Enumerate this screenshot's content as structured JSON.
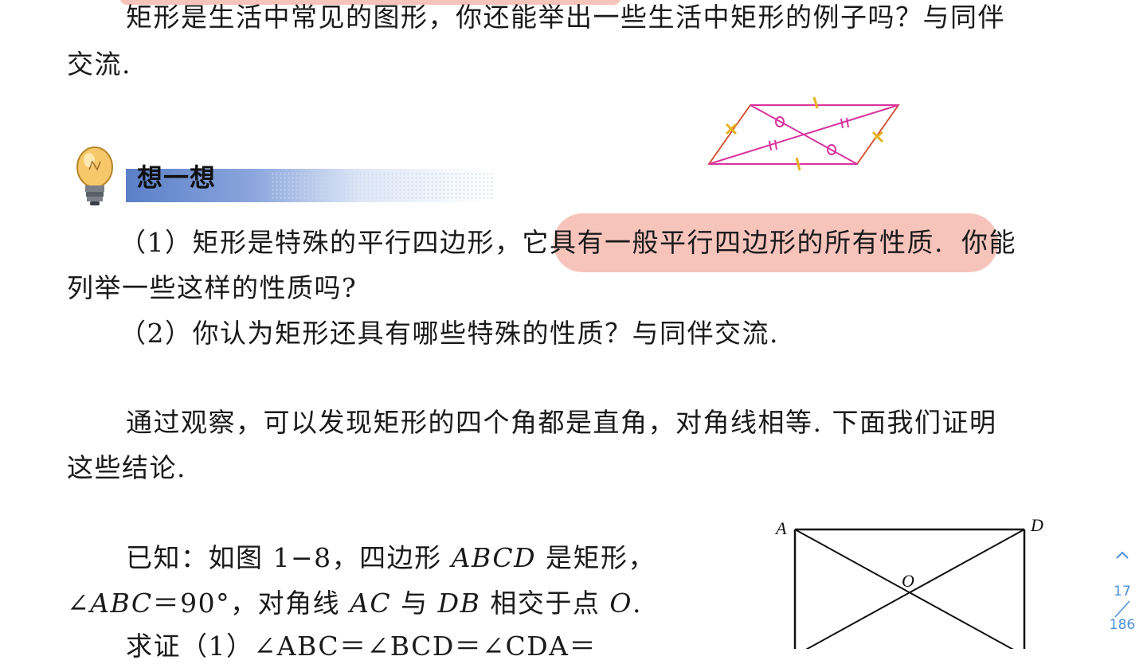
{
  "paragraph1": {
    "line1": "矩形是生活中常见的图形，你还能举出一些生活中矩形的例子吗？与同伴",
    "line2": "交流."
  },
  "think_section": {
    "title": "想一想",
    "q1_line1_a": "（1）矩形是特殊的平行四边形，它",
    "q1_line1_b": "具有一般平行四边形的所有性质.",
    "q1_line1_c": "你能",
    "q1_line2": "列举一些这样的性质吗?",
    "q2": "（2）你认为矩形还具有哪些特殊的性质？与同伴交流."
  },
  "paragraph2": {
    "line1": "通过观察，可以发现矩形的四个角都是直角，对角线相等. 下面我们证明",
    "line2": "这些结论."
  },
  "given": {
    "line1_prefix": "已知：如图 1−8，四边形 ",
    "line1_abcd": "ABCD",
    "line1_suffix": " 是矩形，",
    "line2_angle": "∠",
    "line2_abc": "ABC",
    "line2_mid1": "＝90°，对角线 ",
    "line2_ac": "AC",
    "line2_mid2": " 与 ",
    "line2_db": "DB",
    "line2_mid3": " 相交于点 ",
    "line2_o": "O",
    "line2_end": ".",
    "line3_partial": "求证（1）∠ABC＝∠BCD＝∠CDA＝"
  },
  "figure": {
    "label_a": "A",
    "label_d": "D",
    "label_o": "O"
  },
  "pagination": {
    "current": "17",
    "total": "186"
  },
  "colors": {
    "highlight": "#f4b0a6",
    "sketch_pink": "#d8329e",
    "sketch_red": "#d04a2a",
    "sketch_yellow": "#e8b020",
    "nav_blue": "#4a90d9",
    "banner_blue": "#5a7fc8"
  }
}
